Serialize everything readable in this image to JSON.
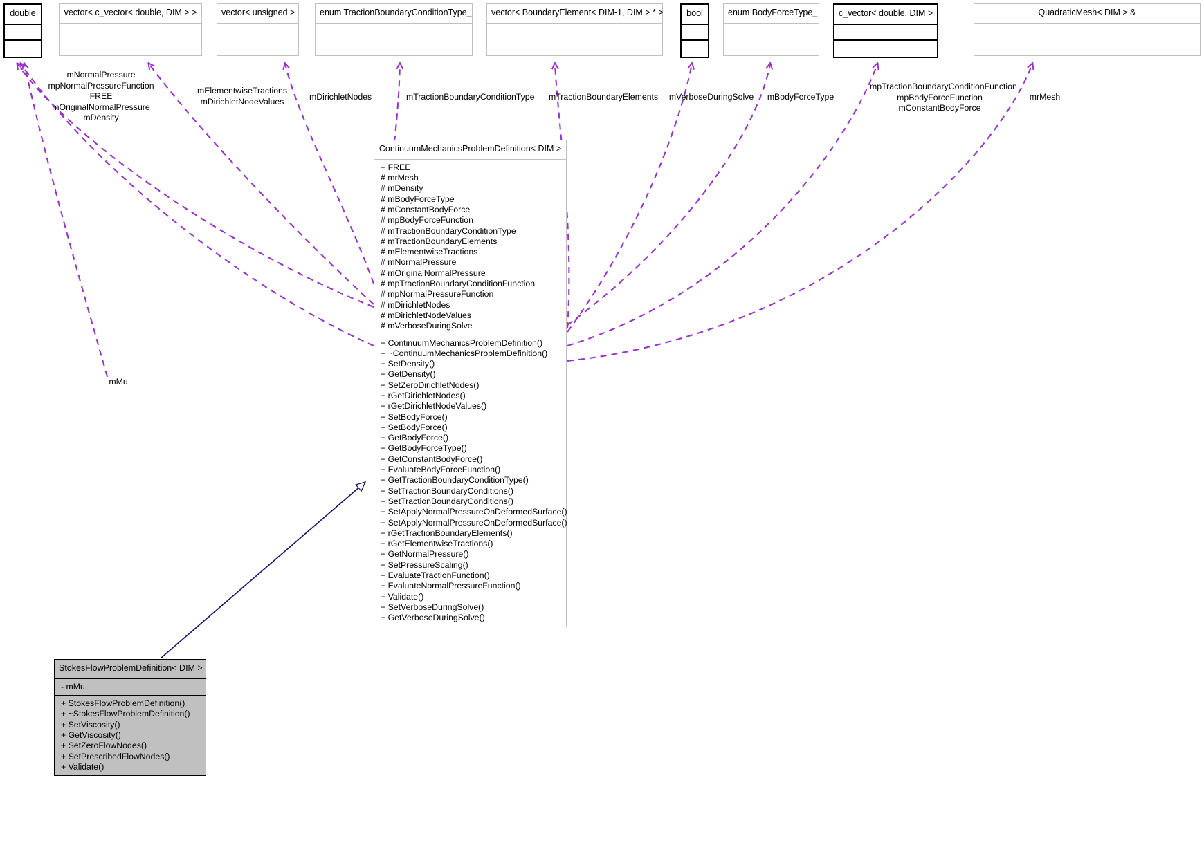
{
  "diagram": {
    "kind": "uml-collaboration-diagram",
    "colors": {
      "association_edge": "#9933cc",
      "inheritance_edge": "#191970",
      "derived_box_fill": "#c0c0c0",
      "box_border_light": "#c0c0c0",
      "box_border_dark": "#000000",
      "background": "#ffffff"
    }
  },
  "type_boxes": [
    {
      "id": "double",
      "title": "double",
      "style": "thick"
    },
    {
      "id": "vector_cvector_double_dim",
      "title": "vector< c_vector< double, DIM > >",
      "style": "light"
    },
    {
      "id": "vector_unsigned",
      "title": "vector< unsigned >",
      "style": "light"
    },
    {
      "id": "enum_tbct",
      "title": "enum TractionBoundaryConditionType_",
      "style": "light"
    },
    {
      "id": "vector_boundaryelement",
      "title": "vector< BoundaryElement< DIM-1, DIM > * >",
      "style": "light"
    },
    {
      "id": "bool",
      "title": "bool",
      "style": "thick"
    },
    {
      "id": "enum_bodyforcetype",
      "title": "enum BodyForceType_",
      "style": "light"
    },
    {
      "id": "c_vector_double_dim",
      "title": "c_vector< double, DIM >",
      "style": "thick"
    },
    {
      "id": "quadraticmesh",
      "title": "QuadraticMesh< DIM > &",
      "style": "light"
    }
  ],
  "main_class": {
    "title": "ContinuumMechanicsProblemDefinition< DIM >",
    "attributes": [
      "+ FREE",
      "# mrMesh",
      "# mDensity",
      "# mBodyForceType",
      "# mConstantBodyForce",
      "# mpBodyForceFunction",
      "# mTractionBoundaryConditionType",
      "# mTractionBoundaryElements",
      "# mElementwiseTractions",
      "# mNormalPressure",
      "# mOriginalNormalPressure",
      "# mpTractionBoundaryConditionFunction",
      "# mpNormalPressureFunction",
      "# mDirichletNodes",
      "# mDirichletNodeValues",
      "# mVerboseDuringSolve"
    ],
    "methods": [
      "+ ContinuumMechanicsProblemDefinition()",
      "+ ~ContinuumMechanicsProblemDefinition()",
      "+ SetDensity()",
      "+ GetDensity()",
      "+ SetZeroDirichletNodes()",
      "+ rGetDirichletNodes()",
      "+ rGetDirichletNodeValues()",
      "+ SetBodyForce()",
      "+ SetBodyForce()",
      "+ GetBodyForce()",
      "+ GetBodyForceType()",
      "+ GetConstantBodyForce()",
      "+ EvaluateBodyForceFunction()",
      "+ GetTractionBoundaryConditionType()",
      "+ SetTractionBoundaryConditions()",
      "+ SetTractionBoundaryConditions()",
      "+ SetApplyNormalPressureOnDeformedSurface()",
      "+ SetApplyNormalPressureOnDeformedSurface()",
      "+ rGetTractionBoundaryElements()",
      "+ rGetElementwiseTractions()",
      "+ GetNormalPressure()",
      "+ SetPressureScaling()",
      "+ EvaluateTractionFunction()",
      "+ EvaluateNormalPressureFunction()",
      "+ Validate()",
      "+ SetVerboseDuringSolve()",
      "+ GetVerboseDuringSolve()"
    ]
  },
  "derived_class": {
    "title": "StokesFlowProblemDefinition< DIM >",
    "attributes": [
      "- mMu"
    ],
    "methods": [
      "+ StokesFlowProblemDefinition()",
      "+ ~StokesFlowProblemDefinition()",
      "+ SetViscosity()",
      "+ GetViscosity()",
      "+ SetZeroFlowNodes()",
      "+ SetPrescribedFlowNodes()",
      "+ Validate()"
    ]
  },
  "edge_labels": [
    {
      "id": "label-double-main",
      "lines": [
        "mNormalPressure",
        "mpNormalPressureFunction",
        "FREE",
        "mOriginalNormalPressure",
        "mDensity"
      ]
    },
    {
      "id": "label-vector-cvector",
      "lines": [
        "mElementwiseTractions",
        "mDirichletNodeValues"
      ]
    },
    {
      "id": "label-vector-unsigned",
      "lines": [
        "mDirichletNodes"
      ]
    },
    {
      "id": "label-enum-tbct",
      "lines": [
        "mTractionBoundaryConditionType"
      ]
    },
    {
      "id": "label-vector-boundaryelement",
      "lines": [
        "mTractionBoundaryElements"
      ]
    },
    {
      "id": "label-bool",
      "lines": [
        "mVerboseDuringSolve"
      ]
    },
    {
      "id": "label-enum-bodyforcetype",
      "lines": [
        "mBodyForceType"
      ]
    },
    {
      "id": "label-cvector-double",
      "lines": [
        "mpTractionBoundaryConditionFunction",
        "mpBodyForceFunction",
        "mConstantBodyForce"
      ]
    },
    {
      "id": "label-quadraticmesh",
      "lines": [
        "mrMesh"
      ]
    },
    {
      "id": "label-mmu",
      "lines": [
        "mMu"
      ]
    }
  ]
}
